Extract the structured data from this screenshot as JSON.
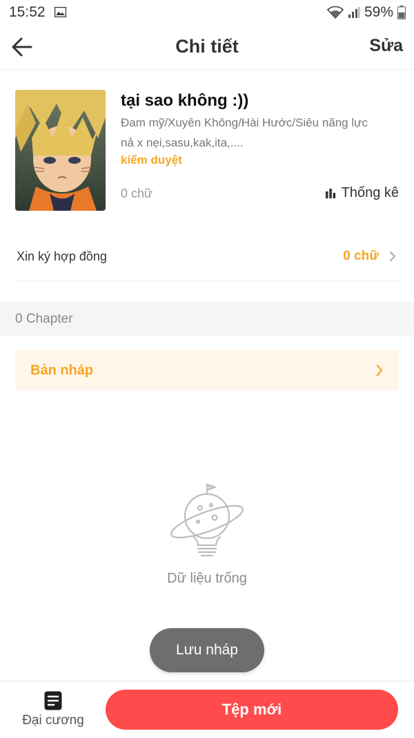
{
  "status_bar": {
    "time": "15:52",
    "battery": "59%",
    "icons": [
      "image-icon",
      "wifi-icon",
      "signal-icon",
      "battery-icon"
    ]
  },
  "header": {
    "title": "Chi tiết",
    "edit_label": "Sửa",
    "back_icon": "arrow-left-icon"
  },
  "book": {
    "title": "tại sao không :))",
    "genres": "Đam mỹ/Xuyên Không/Hài Hước/Siêu năng lực",
    "description": "nả x nẹi,sasu,kak,ita,....",
    "status": "kiểm duyệt",
    "word_count": "0 chữ",
    "stats_label": "Thống kê"
  },
  "contract": {
    "label": "Xin ký hợp đồng",
    "value": "0 chữ"
  },
  "chapters": {
    "count_label": "0 Chapter"
  },
  "draft": {
    "label": "Bản nháp"
  },
  "empty_state": {
    "text": "Dữ liệu trống"
  },
  "save_draft": {
    "label": "Lưu nháp"
  },
  "bottom_bar": {
    "outline_label": "Đại cương",
    "new_file_label": "Tệp mới"
  },
  "colors": {
    "accent_orange": "#f5a623",
    "primary_red": "#ff4b4b",
    "draft_bg": "#fff6ea",
    "toast_gray": "#6e6e6e"
  }
}
